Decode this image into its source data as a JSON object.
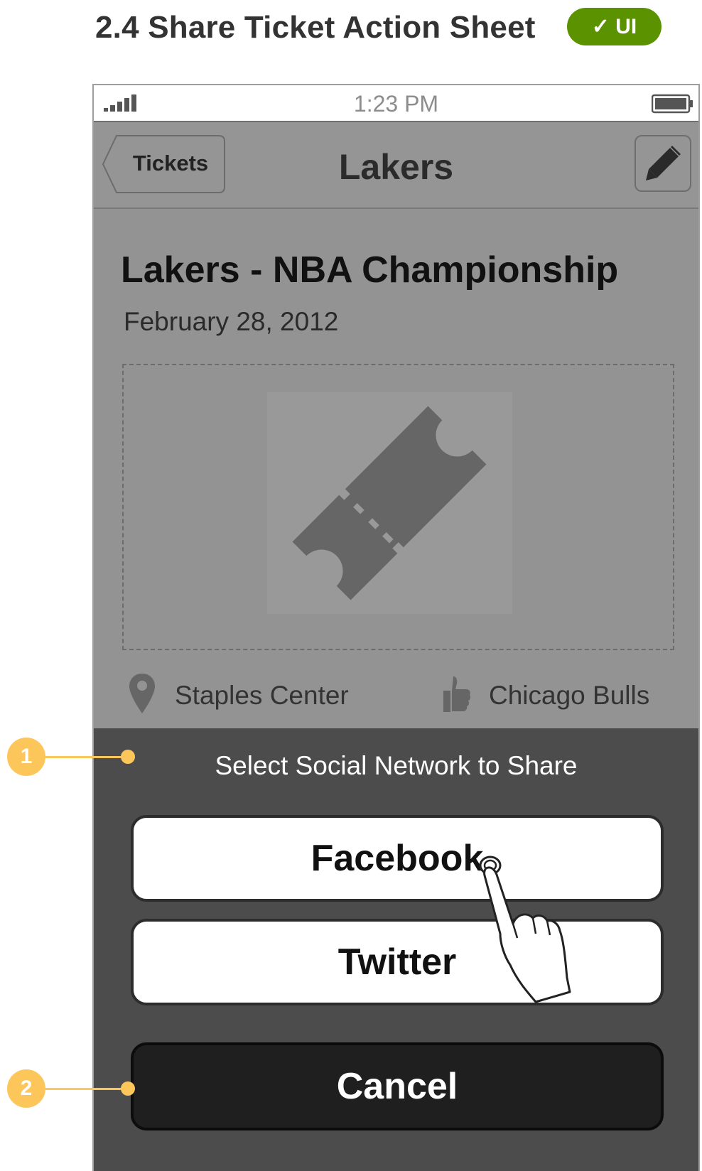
{
  "page": {
    "title": "2.4 Share Ticket Action Sheet",
    "badge": "✓ UI",
    "badge_color": "#5a9200",
    "callout_color": "#fcc65b"
  },
  "status_bar": {
    "time": "1:23 PM",
    "signal_icon": "signal-bars-icon",
    "battery_icon": "battery-icon"
  },
  "nav": {
    "back_label": "Tickets",
    "title": "Lakers",
    "edit_icon": "pencil-icon"
  },
  "event": {
    "title": "Lakers - NBA Championship",
    "date": "February 28, 2012",
    "image_icon": "ticket-icon",
    "venue_icon": "map-pin-icon",
    "venue": "Staples Center",
    "team_icon": "thumbs-up-icon",
    "opponent": "Chicago Bulls"
  },
  "action_sheet": {
    "title": "Select Social Network to Share",
    "buttons": [
      {
        "label": "Facebook"
      },
      {
        "label": "Twitter"
      }
    ],
    "cancel_label": "Cancel"
  },
  "annotations": [
    {
      "number": "1"
    },
    {
      "number": "2"
    }
  ],
  "gesture": {
    "icon": "tap-hand-icon"
  }
}
